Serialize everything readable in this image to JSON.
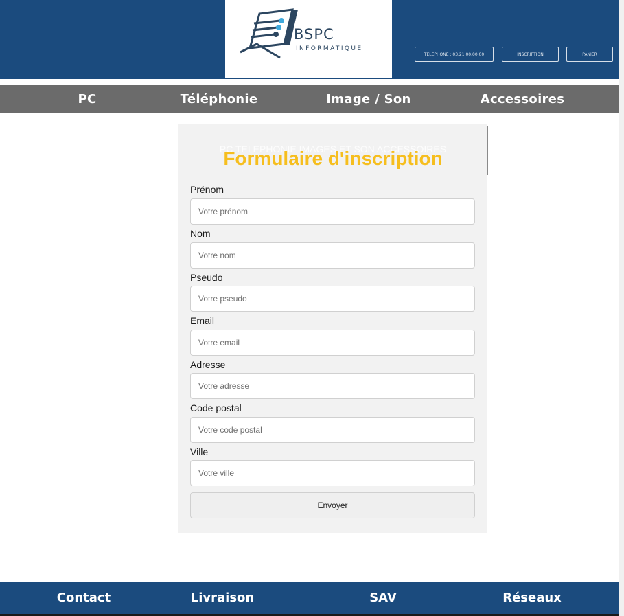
{
  "brand": {
    "name": "BSPC",
    "tagline": "INFORMATIQUE"
  },
  "header_buttons": {
    "telephone": "TELEPHONE : 03.21.00.00.00",
    "inscription": "INSCRIPTION",
    "panier": "PANIER"
  },
  "nav": [
    "PC",
    "Téléphonie",
    "Image / Son",
    "Accessoires"
  ],
  "ghost_menu": "PC TELEPHONIE IMAGES ET SON ACCESSOIRES",
  "form": {
    "title": "Formulaire d'inscription",
    "fields": [
      {
        "label": "Prénom",
        "placeholder": "Votre prénom"
      },
      {
        "label": "Nom",
        "placeholder": "Votre nom"
      },
      {
        "label": "Pseudo",
        "placeholder": "Votre pseudo"
      },
      {
        "label": "Email",
        "placeholder": "Votre email"
      },
      {
        "label": "Adresse",
        "placeholder": "Votre adresse"
      },
      {
        "label": "Code postal",
        "placeholder": "Votre code postal"
      },
      {
        "label": "Ville",
        "placeholder": "Votre ville"
      }
    ],
    "submit": "Envoyer"
  },
  "footer": [
    "Contact",
    "Livraison",
    "SAV",
    "Réseaux"
  ],
  "colors": {
    "primary": "#1b4b7e",
    "nav_bg": "#6b6b6b",
    "title": "#f6be1e",
    "panel": "#f2f2f2"
  }
}
